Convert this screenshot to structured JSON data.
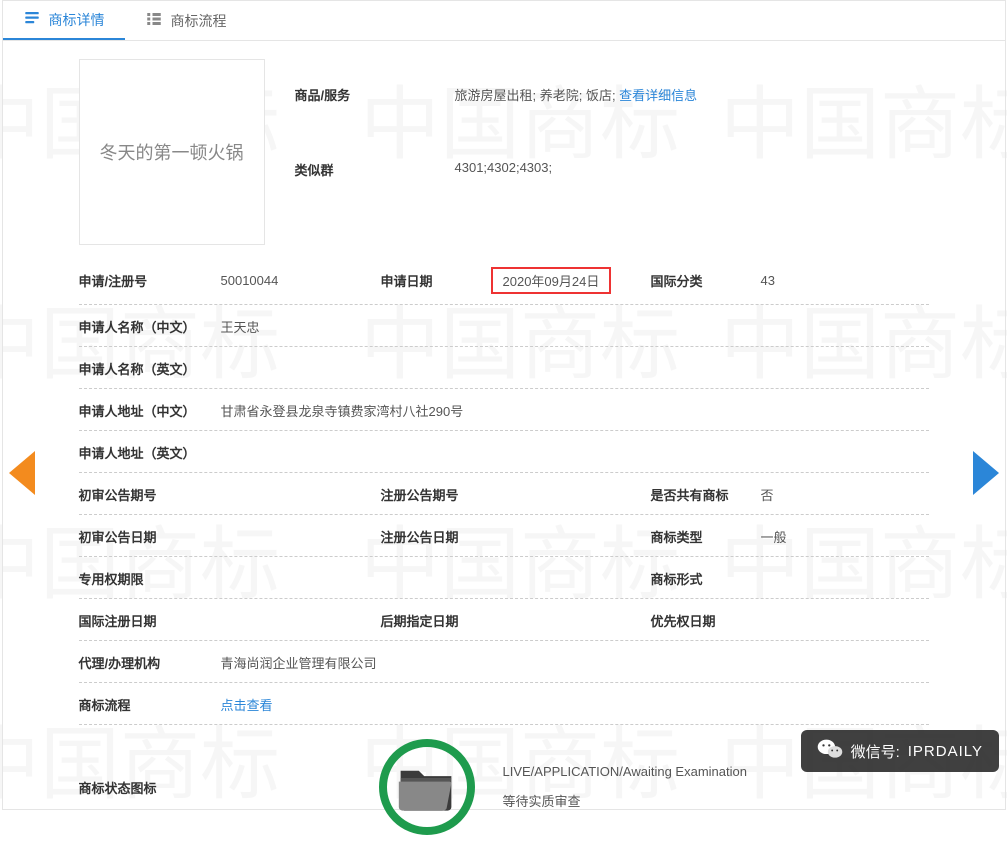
{
  "tabs": {
    "detail": "商标详情",
    "process": "商标流程"
  },
  "trademark_text": "冬天的第一顿火锅",
  "top": {
    "goods_label": "商品/服务",
    "goods_value": "旅游房屋出租; 养老院; 饭店; ",
    "goods_link": "查看详细信息",
    "group_label": "类似群",
    "group_value": "4301;4302;4303;"
  },
  "row1": {
    "reg_no_label": "申请/注册号",
    "reg_no_value": "50010044",
    "app_date_label": "申请日期",
    "app_date_value": "2020年09月24日",
    "intl_class_label": "国际分类",
    "intl_class_value": "43"
  },
  "row2": {
    "label": "申请人名称（中文）",
    "value": "王天忠"
  },
  "row3": {
    "label": "申请人名称（英文）",
    "value": ""
  },
  "row4": {
    "label": "申请人地址（中文）",
    "value": "甘肃省永登县龙泉寺镇费家湾村八社290号"
  },
  "row5": {
    "label": "申请人地址（英文）",
    "value": ""
  },
  "row6": {
    "c1l": "初审公告期号",
    "c1v": "",
    "c2l": "注册公告期号",
    "c2v": "",
    "c3l": "是否共有商标",
    "c3v": "否"
  },
  "row7": {
    "c1l": "初审公告日期",
    "c1v": "",
    "c2l": "注册公告日期",
    "c2v": "",
    "c3l": "商标类型",
    "c3v": "一般"
  },
  "row8": {
    "c1l": "专用权期限",
    "c1v": "",
    "c2l": "",
    "c2v": "",
    "c3l": "商标形式",
    "c3v": ""
  },
  "row9": {
    "c1l": "国际注册日期",
    "c1v": "",
    "c2l": "后期指定日期",
    "c2v": "",
    "c3l": "优先权日期",
    "c3v": ""
  },
  "row10": {
    "label": "代理/办理机构",
    "value": "青海尚润企业管理有限公司"
  },
  "row11": {
    "label": "商标流程",
    "link": "点击查看"
  },
  "status_row": {
    "label": "商标状态图标",
    "line1": "LIVE/APPLICATION/Awaiting Examination",
    "line2": "等待实质审查"
  },
  "overlay": {
    "prefix": "微信号:",
    "id": "IPRDAILY"
  },
  "watermark": "中国商标"
}
